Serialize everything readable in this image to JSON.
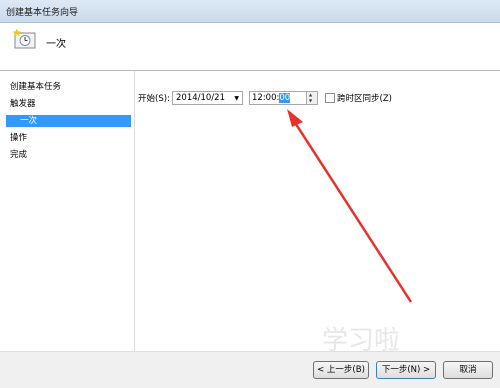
{
  "window": {
    "title": "创建基本任务向导"
  },
  "header": {
    "title": "一次",
    "icon": "clock-icon"
  },
  "sidebar": {
    "items": [
      {
        "label": "创建基本任务"
      },
      {
        "label": "触发器"
      },
      {
        "label": "一次",
        "active": true
      },
      {
        "label": "操作"
      },
      {
        "label": "完成"
      }
    ]
  },
  "form": {
    "start_label": "开始(S):",
    "date_value": "2014/10/21",
    "time_prefix": "12:00:",
    "time_selected": "00",
    "sync_label": "跨时区同步(Z)",
    "sync_checked": false
  },
  "buttons": {
    "back": "< 上一步(B)",
    "next": "下一步(N) >",
    "cancel": "取消"
  },
  "annotation": {
    "arrow_color": "#e8312b"
  },
  "watermark": {
    "text": "学习啦"
  }
}
